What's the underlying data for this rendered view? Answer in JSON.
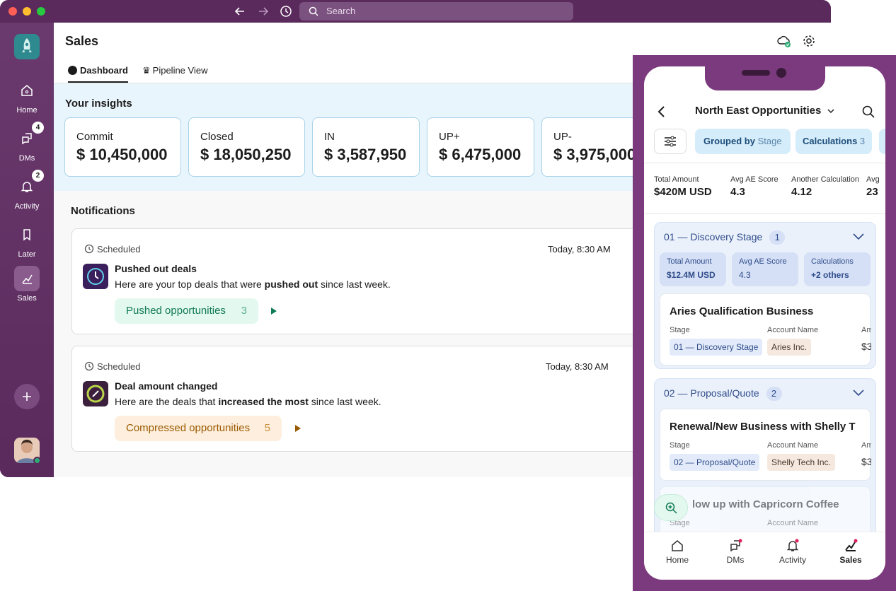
{
  "desktop": {
    "search_placeholder": "Search",
    "sidebar": {
      "items": [
        {
          "label": "Home",
          "badge": ""
        },
        {
          "label": "DMs",
          "badge": "4"
        },
        {
          "label": "Activity",
          "badge": "2"
        },
        {
          "label": "Later",
          "badge": ""
        },
        {
          "label": "Sales",
          "badge": ""
        }
      ]
    },
    "header": {
      "title": "Sales"
    },
    "tabs": [
      {
        "label": "Dashboard"
      },
      {
        "label": "Pipeline View"
      }
    ],
    "insights": {
      "title": "Your insights",
      "cards": [
        {
          "label": "Commit",
          "value": "$ 10,450,000"
        },
        {
          "label": "Closed",
          "value": "$ 18,050,250"
        },
        {
          "label": "IN",
          "value": "$ 3,587,950"
        },
        {
          "label": "UP+",
          "value": "$ 6,475,000"
        },
        {
          "label": "UP-",
          "value": "$ 3,975,000"
        }
      ]
    },
    "notifications": {
      "title": "Notifications",
      "items": [
        {
          "tag": "Scheduled",
          "time": "Today, 8:30 AM",
          "title": "Pushed out deals",
          "text_before": "Here are your top deals that were ",
          "text_bold": "pushed out",
          "text_after": " since last week.",
          "pill_label": "Pushed opportunities",
          "pill_count": "3"
        },
        {
          "tag": "Scheduled",
          "time": "Today, 8:30 AM",
          "title": "Deal amount changed",
          "text_before": "Here are the deals that ",
          "text_bold": "increased the most",
          "text_after": " since last week.",
          "pill_label": "Compressed opportunities",
          "pill_count": "5"
        }
      ]
    }
  },
  "mobile": {
    "title": "North East Opportunities",
    "chips": {
      "grouped_label": "Grouped by",
      "grouped_value": "Stage",
      "calc_label": "Calculations",
      "calc_value": "3"
    },
    "summary": [
      {
        "label": "Total Amount",
        "value": "$420M USD"
      },
      {
        "label": "Avg AE Score",
        "value": "4.3"
      },
      {
        "label": "Another Calculation",
        "value": "4.12"
      },
      {
        "label": "Avg",
        "value": "23"
      }
    ],
    "groups": [
      {
        "name": "01 — Discovery Stage",
        "count": "1",
        "stats": [
          {
            "label": "Total Amount",
            "value": "$12.4M USD"
          },
          {
            "label": "Avg AE Score",
            "value": "4.3"
          },
          {
            "label": "Calculations",
            "value": "+2 others"
          }
        ],
        "deal": {
          "title": "Aries Qualification Business",
          "stage_label": "Stage",
          "stage": "01 — Discovery Stage",
          "account_label": "Account Name",
          "account": "Aries Inc.",
          "amount_label": "Am",
          "amount": "$3"
        }
      },
      {
        "name": "02 — Proposal/Quote",
        "count": "2",
        "deal": {
          "title": "Renewal/New Business with Shelly T",
          "stage_label": "Stage",
          "stage": "02 — Proposal/Quote",
          "account_label": "Account Name",
          "account": "Shelly Tech Inc.",
          "amount_label": "Am",
          "amount": "$3"
        },
        "deal2": {
          "title": "low up with Capricorn Coffee",
          "stage_label": "Stage",
          "account_label": "Account Name"
        }
      }
    ],
    "tabbar": [
      {
        "label": "Home"
      },
      {
        "label": "DMs"
      },
      {
        "label": "Activity"
      },
      {
        "label": "Sales"
      }
    ]
  },
  "colors": {
    "aubergine": "#5a2a5c",
    "insights_bg": "#e9f5fc",
    "green_pill": "#e3f8ef",
    "green_text": "#107a55",
    "orange_pill": "#fdeedd",
    "orange_text": "#9a5a00",
    "blue_text": "#2f4c8a"
  }
}
